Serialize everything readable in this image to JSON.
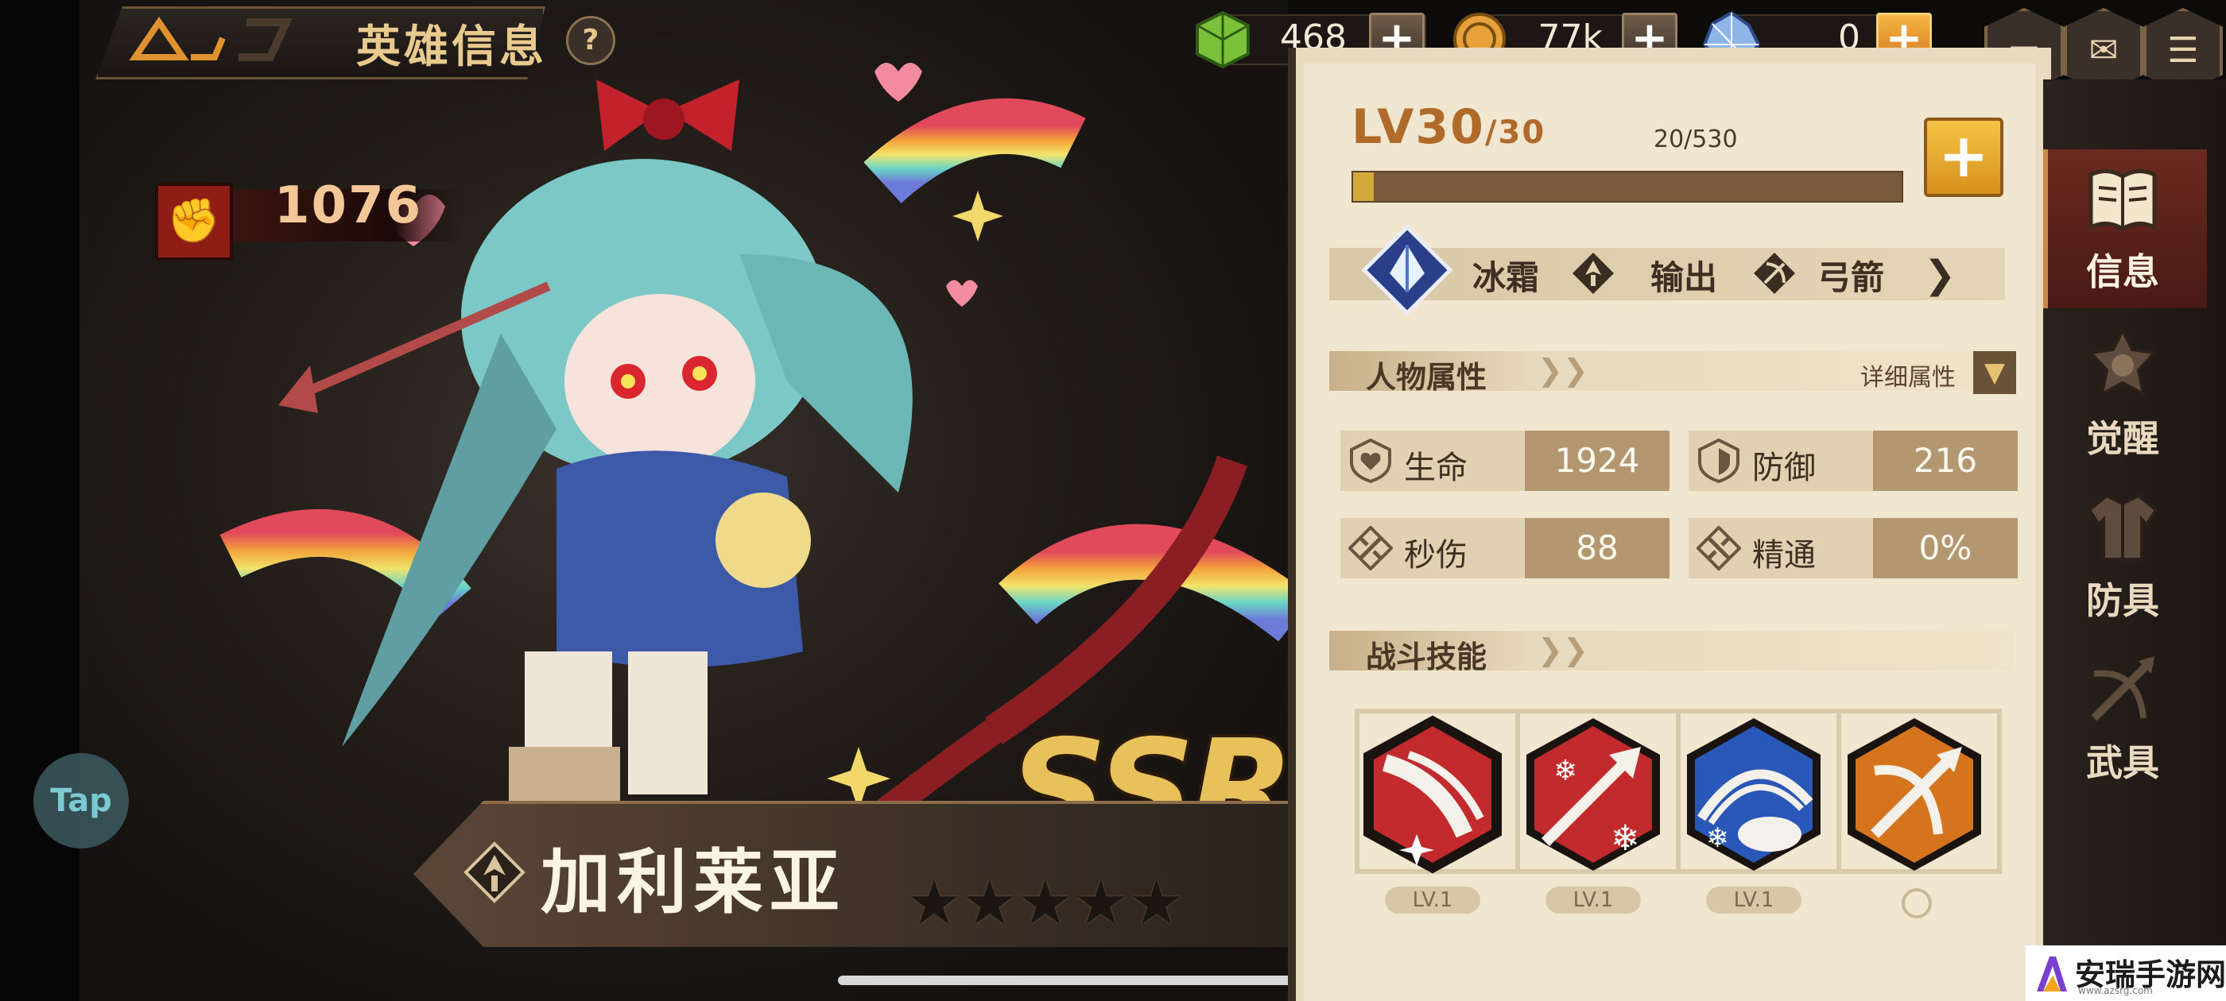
{
  "header": {
    "title": "英雄信息",
    "help_glyph": "?"
  },
  "currencies": [
    {
      "icon": "green-cube-icon",
      "value": "468"
    },
    {
      "icon": "gold-coin-icon",
      "value": "77k"
    },
    {
      "icon": "blue-crystal-icon",
      "value": "0"
    }
  ],
  "plus_glyph": "+",
  "top_right_buttons": [
    "chat-icon",
    "mail-icon",
    "menu-icon"
  ],
  "hero": {
    "power": "1076",
    "name": "加利莱亚",
    "rarity": "SSR",
    "stars": 5,
    "star_glyphs": "★★★★★"
  },
  "tap_label": "Tap",
  "level": {
    "label": "LV30",
    "max": "/30",
    "exp_text": "20/530",
    "exp_fraction": 0.038
  },
  "tags": {
    "element": "冰霜",
    "role": "输出",
    "weapon": "弓箭"
  },
  "attributes": {
    "section_title": "人物属性",
    "detail_label": "详细属性",
    "stats": [
      {
        "icon": "heart-shield-icon",
        "name": "生命",
        "value": "1924"
      },
      {
        "icon": "shield-icon",
        "name": "防御",
        "value": "216"
      },
      {
        "icon": "sword-icon",
        "name": "秒伤",
        "value": "88"
      },
      {
        "icon": "mastery-icon",
        "name": "精通",
        "value": "0%"
      }
    ]
  },
  "skills": {
    "section_title": "战斗技能",
    "items": [
      {
        "icon": "shooting-star-skill-icon",
        "level": "LV.1"
      },
      {
        "icon": "frost-arrow-skill-icon",
        "level": "LV.1"
      },
      {
        "icon": "rainbow-cloud-skill-icon",
        "level": "LV.1"
      },
      {
        "icon": "crossbow-skill-icon",
        "level": ""
      }
    ]
  },
  "sidebar": {
    "items": [
      {
        "label": "信息",
        "icon": "book-icon",
        "active": true
      },
      {
        "label": "觉醒",
        "icon": "awaken-crest-icon",
        "active": false
      },
      {
        "label": "防具",
        "icon": "armor-icon",
        "active": false
      },
      {
        "label": "武具",
        "icon": "crossbow-icon",
        "active": false
      }
    ]
  },
  "watermark": {
    "text": "安瑞手游网",
    "sub": "www.azsrg.com"
  },
  "colors": {
    "accent_gold": "#e8c15a",
    "panel_bg": "#f1e7d1",
    "stat_value_bg": "#b39770",
    "power_red": "#8e1d16"
  }
}
